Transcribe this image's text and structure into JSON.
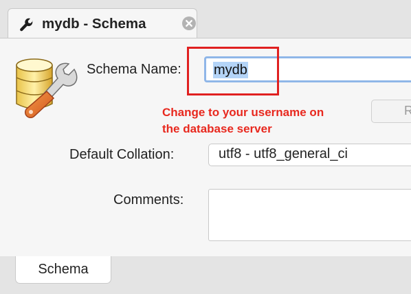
{
  "tab": {
    "title": "mydb - Schema",
    "icon": "wrench-icon",
    "close_icon": "close-icon"
  },
  "form": {
    "schema_name_label": "Schema Name:",
    "schema_name_value": "mydb",
    "default_collation_label": "Default Collation:",
    "default_collation_value": "utf8 - utf8_general_ci",
    "comments_label": "Comments:",
    "comments_value": "",
    "partial_button_label": "R"
  },
  "annotation": {
    "line1": "Change to your username on",
    "line2": "the database server",
    "color": "#e8281e"
  },
  "bottom_tabs": [
    {
      "label": "Schema"
    }
  ],
  "colors": {
    "highlight_border": "#e02020",
    "focus_ring": "#8fb6e8",
    "selection": "#b4d4f7"
  }
}
